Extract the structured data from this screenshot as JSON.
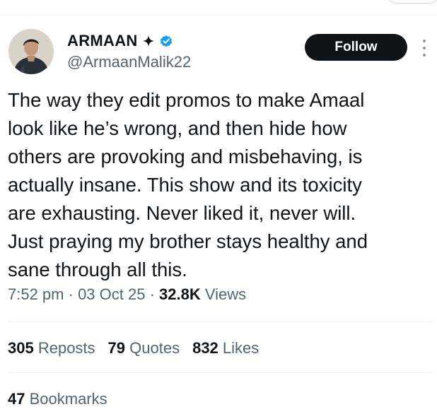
{
  "author": {
    "display_name": "ARMAAN",
    "handle": "@ArmaanMalik22",
    "avatar_icon": "profile-photo",
    "badge_icon": "verified-badge",
    "accent_color": "#1d9bf0"
  },
  "follow": {
    "label": "Follow"
  },
  "tweet": {
    "lines": [
      "The way they edit promos to make Amaal",
      "look like he’s wrong, and then hide how",
      "others are provoking and misbehaving, is",
      "actually insane. This show and its toxicity",
      "are exhausting. Never liked it, never will.",
      "Just praying my brother stays healthy and",
      "sane through all this."
    ]
  },
  "meta": {
    "time": "7:52 pm",
    "sep1": " · ",
    "date": "03 Oct 25",
    "sep2": " · ",
    "views_count": "32.8K",
    "views_label": " Views"
  },
  "stats": {
    "reposts": {
      "count": "305",
      "label": " Reposts"
    },
    "quotes": {
      "count": "79",
      "label": " Quotes"
    },
    "likes": {
      "count": "832",
      "label": " Likes"
    },
    "bookmarks": {
      "count": "47",
      "label": " Bookmarks"
    }
  }
}
